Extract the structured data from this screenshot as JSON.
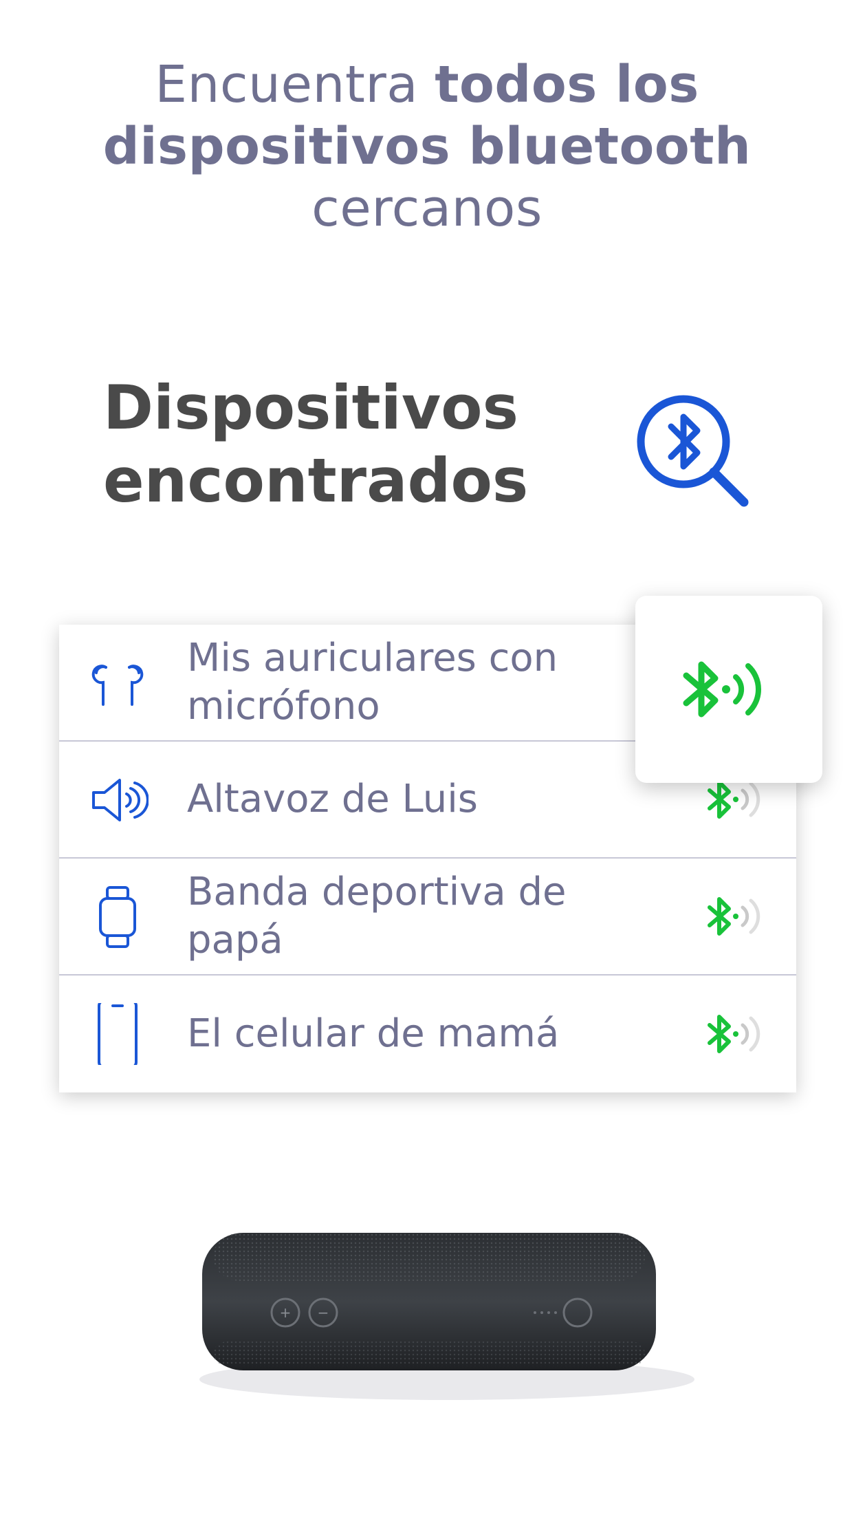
{
  "headline": {
    "part1": "Encuentra ",
    "bold": "todos los dispositivos bluetooth",
    "part2": " cercanos"
  },
  "section_title": {
    "line1": "Dispositivos",
    "line2": "encontrados"
  },
  "scan_button": {
    "icon": "bluetooth-search-icon",
    "color": "#1a56d6"
  },
  "devices": [
    {
      "name": "Mis auriculares con micrófono",
      "icon": "earbuds-icon",
      "signal": "strong"
    },
    {
      "name": "Altavoz de Luis",
      "icon": "speaker-icon",
      "signal": "weak"
    },
    {
      "name": "Banda deportiva de papá",
      "icon": "watch-icon",
      "signal": "weak"
    },
    {
      "name": "El celular de mamá",
      "icon": "phone-icon",
      "signal": "weak"
    }
  ],
  "colors": {
    "accent_blue": "#1a56d6",
    "signal_green": "#19c23a",
    "text_gray": "#6f7090",
    "title_dark": "#4a4a4a"
  }
}
